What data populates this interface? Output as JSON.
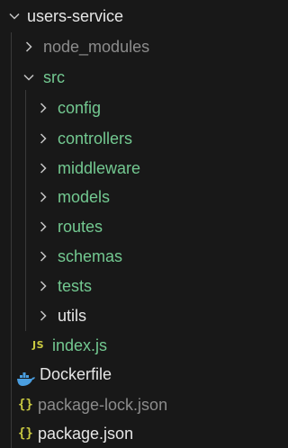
{
  "explorer": {
    "root": {
      "label": "users-service",
      "expanded": true
    },
    "items": [
      {
        "label": "node_modules",
        "expanded": false
      },
      {
        "label": "src",
        "expanded": true
      },
      {
        "label": "config",
        "expanded": false
      },
      {
        "label": "controllers",
        "expanded": false
      },
      {
        "label": "middleware",
        "expanded": false
      },
      {
        "label": "models",
        "expanded": false
      },
      {
        "label": "routes",
        "expanded": false
      },
      {
        "label": "schemas",
        "expanded": false
      },
      {
        "label": "tests",
        "expanded": false
      },
      {
        "label": "utils",
        "expanded": false
      },
      {
        "label": "index.js",
        "icon_text": "JS"
      },
      {
        "label": "Dockerfile",
        "icon": "docker-whale-icon"
      },
      {
        "label": "package-lock.json",
        "icon_text": "{}"
      },
      {
        "label": "package.json",
        "icon_text": "{}"
      }
    ]
  },
  "colors": {
    "background": "#181818",
    "root_text": "#e6e6e6",
    "folder_text": "#e6e6e6",
    "ignored_text": "#8c8c8c",
    "modified_text": "#73c991",
    "js_icon": "#cbcb41",
    "json_icon": "#cbcb41",
    "docker_icon": "#4a9ee0",
    "chevron": "#c5c5c5",
    "indent_guide": "#3a3a3a"
  }
}
